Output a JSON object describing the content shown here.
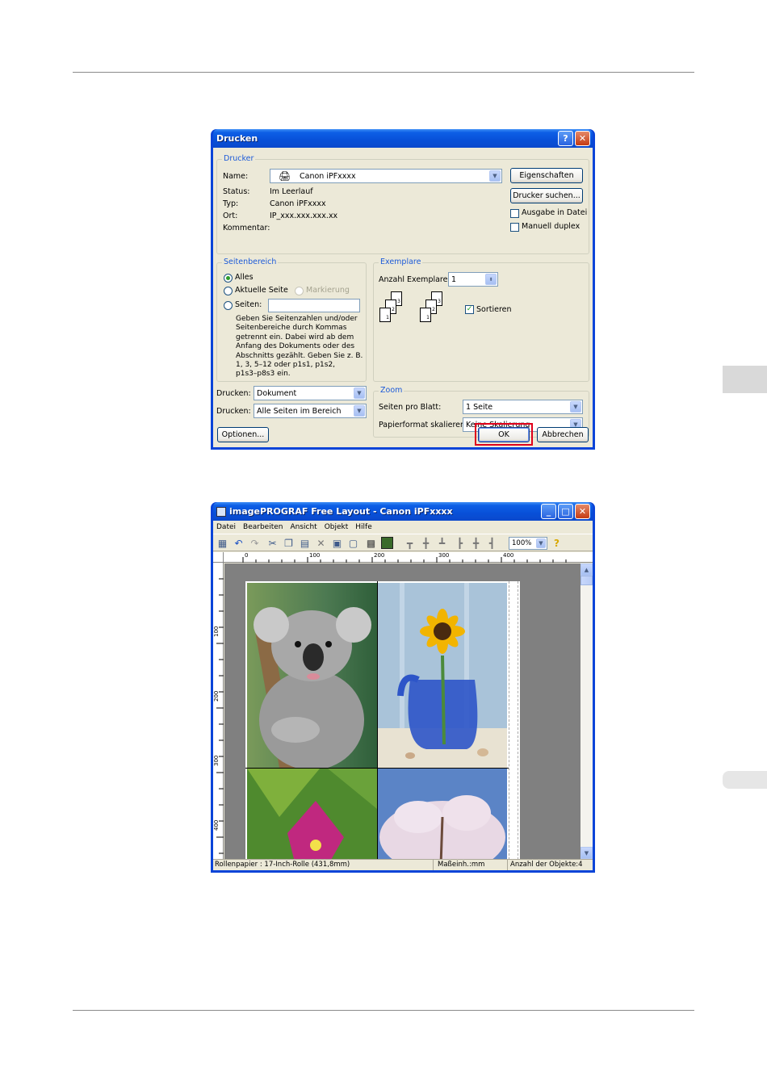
{
  "print_dialog": {
    "title": "Drucken",
    "printer_group": "Drucker",
    "name_label": "Name:",
    "printer_name": "Canon iPFxxxx",
    "status_label": "Status:",
    "status_value": "Im Leerlauf",
    "type_label": "Typ:",
    "type_value": "Canon iPFxxxx",
    "location_label": "Ort:",
    "location_value": "IP_xxx.xxx.xxx.xx",
    "comment_label": "Kommentar:",
    "properties_button": "Eigenschaften",
    "find_printer_button": "Drucker suchen...",
    "print_to_file_label": "Ausgabe in Datei",
    "manual_duplex_label": "Manuell duplex",
    "page_range_group": "Seitenbereich",
    "all_label": "Alles",
    "current_page_label": "Aktuelle Seite",
    "selection_label": "Markierung",
    "pages_label": "Seiten:",
    "pages_help": [
      "Geben Sie Seitenzahlen und/oder",
      "Seitenbereiche durch Kommas",
      "getrennt ein. Dabei wird ab dem",
      "Anfang des Dokuments oder des",
      "Abschnitts gezählt. Geben Sie z. B.",
      "1, 3, 5–12 oder p1s1, p1s2,",
      "p1s3–p8s3 ein."
    ],
    "copies_group": "Exemplare",
    "copies_label": "Anzahl Exemplare:",
    "copies_value": "1",
    "collate_label": "Sortieren",
    "print_what_label": "Drucken:",
    "print_what_value": "Dokument",
    "print_label": "Drucken:",
    "print_value": "Alle Seiten im Bereich",
    "zoom_group": "Zoom",
    "pages_per_sheet_label": "Seiten pro Blatt:",
    "pages_per_sheet_value": "1 Seite",
    "scale_label": "Papierformat skalieren:",
    "scale_value": "Keine Skalierung",
    "options_button": "Optionen...",
    "ok_button": "OK",
    "cancel_button": "Abbrechen",
    "help_button": "?",
    "close_button": "✕",
    "highlight_color": "#e0001b"
  },
  "layout_window": {
    "title": "imagePROGRAF Free Layout - Canon iPFxxxx",
    "menu": [
      "Datei",
      "Bearbeiten",
      "Ansicht",
      "Objekt",
      "Hilfe"
    ],
    "zoom_value": "100%",
    "ruler_h_labels": [
      "0",
      "100",
      "200",
      "300",
      "400"
    ],
    "ruler_v_labels": [
      "100",
      "200",
      "300",
      "400"
    ],
    "status_paper": "Rollenpapier : 17-Inch-Rolle (431,8mm)",
    "status_unit": "Maßeinh.:mm",
    "status_count": "Anzahl der Objekte:4",
    "window_buttons": [
      "_",
      "□",
      "✕"
    ],
    "icons": [
      "printer-icon",
      "undo-icon",
      "redo-icon",
      "cut-icon",
      "copy-icon",
      "paste-icon",
      "delete-icon",
      "front-icon",
      "back-icon",
      "layout-icon",
      "image-icon",
      "align-top-icon",
      "align-center-icon",
      "align-bottom-icon",
      "align-left-icon",
      "align-middle-icon",
      "align-right-icon",
      "help-icon"
    ],
    "photos": [
      "koala-photo",
      "sunflower-photo",
      "bougainvillea-photo",
      "cherry-blossom-photo"
    ]
  },
  "colors": {
    "xp_blue": "#0a44d8",
    "dialog_bg": "#ece9d8",
    "canvas_gray": "#808080",
    "side_tab": "#e0e0e0"
  }
}
